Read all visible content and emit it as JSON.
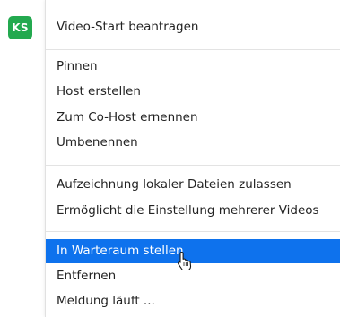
{
  "participant": {
    "initials": "KS"
  },
  "menu": {
    "groups": [
      {
        "items": [
          {
            "label": "Video-Start beantragen",
            "selected": false
          }
        ]
      },
      {
        "items": [
          {
            "label": "Pinnen",
            "selected": false
          },
          {
            "label": "Host erstellen",
            "selected": false
          },
          {
            "label": "Zum Co-Host ernennen",
            "selected": false
          },
          {
            "label": "Umbenennen",
            "selected": false
          }
        ]
      },
      {
        "items": [
          {
            "label": "Aufzeichnung lokaler Dateien zulassen",
            "selected": false
          },
          {
            "label": "Ermöglicht die Einstellung mehrerer Videos",
            "selected": false
          }
        ]
      },
      {
        "items": [
          {
            "label": "In Warteraum stellen",
            "selected": true
          },
          {
            "label": "Entfernen",
            "selected": false
          },
          {
            "label": "Meldung läuft ...",
            "selected": false
          }
        ]
      }
    ]
  },
  "colors": {
    "avatar_bg": "#23a94f",
    "highlight": "#0e72ed"
  },
  "cursor_icon": "hand-pointer-icon"
}
